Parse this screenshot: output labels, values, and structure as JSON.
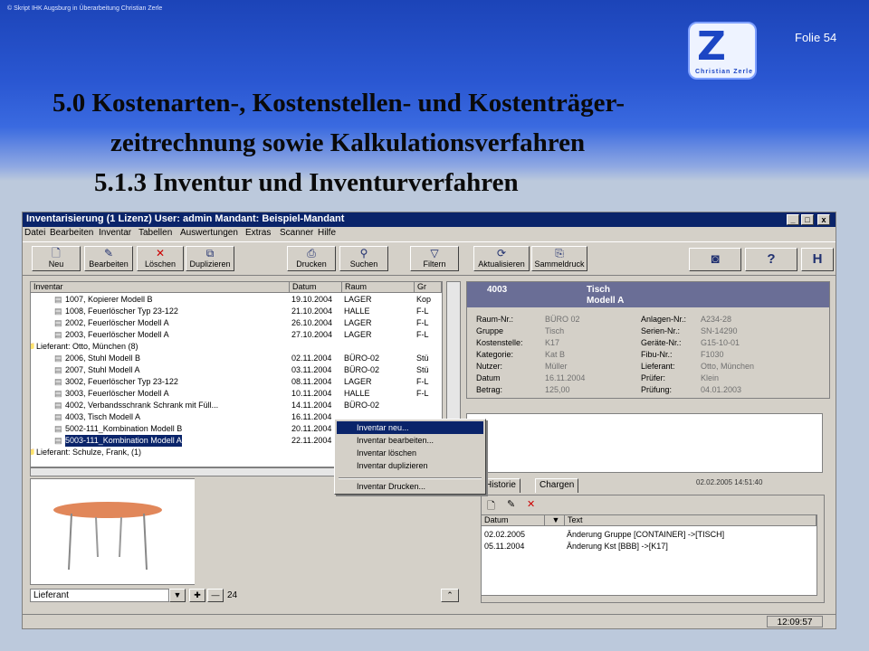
{
  "slide": {
    "copyright": "© Skript IHK Augsburg in Überarbeitung Christian Zerle",
    "folie": "Folie 54",
    "logo_text": "Christian Zerle",
    "title_line1": "5.0   Kostenarten-, Kostenstellen- und Kostenträger-",
    "title_line2": "zeitrechnung sowie Kalkulationsverfahren",
    "subtitle": "5.1.3  Inventur und Inventurverfahren"
  },
  "app": {
    "window_title": "Inventarisierung (1 Lizenz)  User: admin  Mandant: Beispiel-Mandant",
    "window_buttons": [
      "_",
      "□",
      "x"
    ],
    "menu": [
      "Datei",
      "Bearbeiten",
      "Inventar",
      "Tabellen",
      "Auswertungen",
      "Extras",
      "Scanner",
      "Hilfe"
    ],
    "toolbar": [
      {
        "label": "Neu",
        "icon": "new-doc-icon"
      },
      {
        "label": "Bearbeiten",
        "icon": "edit-icon"
      },
      {
        "label": "Löschen",
        "icon": "delete-icon"
      },
      {
        "label": "Duplizieren",
        "icon": "duplicate-icon"
      },
      {
        "label": "Drucken",
        "icon": "print-icon"
      },
      {
        "label": "Suchen",
        "icon": "binoculars-icon"
      },
      {
        "label": "Filtern",
        "icon": "filter-icon"
      },
      {
        "label": "Aktualisieren",
        "icon": "refresh-icon"
      },
      {
        "label": "Sammeldruck",
        "icon": "batch-print-icon"
      }
    ],
    "tree_columns": [
      "Inventar",
      "Datum",
      "Raum",
      "Gr"
    ],
    "tree_rows": [
      {
        "name": "1007, Kopierer Modell B",
        "date": "19.10.2004",
        "room": "LAGER",
        "gr": "Kop",
        "group": false
      },
      {
        "name": "1008, Feuerlöscher Typ 23-122",
        "date": "21.10.2004",
        "room": "HALLE",
        "gr": "F-L",
        "group": false
      },
      {
        "name": "2002, Feuerlöscher Modell A",
        "date": "26.10.2004",
        "room": "LAGER",
        "gr": "F-L",
        "group": false
      },
      {
        "name": "2003, Feuerlöscher Modell A",
        "date": "27.10.2004",
        "room": "LAGER",
        "gr": "F-L",
        "group": false
      },
      {
        "name": "Lieferant: Otto, München (8)",
        "date": "",
        "room": "",
        "gr": "",
        "group": true
      },
      {
        "name": "2006, Stuhl Modell B",
        "date": "02.11.2004",
        "room": "BÜRO-02",
        "gr": "Stü",
        "group": false
      },
      {
        "name": "2007, Stuhl Modell A",
        "date": "03.11.2004",
        "room": "BÜRO-02",
        "gr": "Stü",
        "group": false
      },
      {
        "name": "3002, Feuerlöscher Typ 23-122",
        "date": "08.11.2004",
        "room": "LAGER",
        "gr": "F-L",
        "group": false
      },
      {
        "name": "3003, Feuerlöscher Modell A",
        "date": "10.11.2004",
        "room": "HALLE",
        "gr": "F-L",
        "group": false
      },
      {
        "name": "4002, Verbandsschrank Schrank mit Füll...",
        "date": "14.11.2004",
        "room": "BÜRO-02",
        "gr": "",
        "group": false
      },
      {
        "name": "4003, Tisch Modell A",
        "date": "16.11.2004",
        "room": "",
        "gr": "",
        "group": false
      },
      {
        "name": "5002-111_Kombination Modell B",
        "date": "20.11.2004",
        "room": "",
        "gr": "",
        "group": false
      },
      {
        "name": "5003-111_Kombination Modell A",
        "date": "22.11.2004",
        "room": "",
        "gr": "",
        "group": false,
        "selected": true
      },
      {
        "name": "Lieferant: Schulze, Frank, (1)",
        "date": "",
        "room": "",
        "gr": "",
        "group": true
      }
    ],
    "filter_value": "Lieferant",
    "filter_count": "24",
    "detail": {
      "id": "4003",
      "name1": "Tisch",
      "name2": "Modell A",
      "left_fields": [
        {
          "label": "Raum-Nr.:",
          "value": "BÜRO 02"
        },
        {
          "label": "Gruppe",
          "value": "Tisch"
        },
        {
          "label": "Kostenstelle:",
          "value": "K17"
        },
        {
          "label": "Kategorie:",
          "value": "Kat B"
        },
        {
          "label": "Nutzer:",
          "value": "Müller"
        },
        {
          "label": "Datum",
          "value": "16.11.2004"
        },
        {
          "label": "Betrag:",
          "value": "125,00"
        }
      ],
      "right_fields": [
        {
          "label": "Anlagen-Nr.:",
          "value": "A234-28"
        },
        {
          "label": "Serien-Nr.:",
          "value": "SN-14290"
        },
        {
          "label": "Geräte-Nr.:",
          "value": "G15-10-01"
        },
        {
          "label": "Fibu-Nr.:",
          "value": "F1030"
        },
        {
          "label": "Lieferant:",
          "value": "Otto, München"
        },
        {
          "label": "Prüfer:",
          "value": "Klein"
        },
        {
          "label": "Prüfung:",
          "value": "04.01.2003"
        }
      ],
      "memo_timestamp": "02.02.2005 14:51:40"
    },
    "tabs": [
      "Historie",
      "Chargen"
    ],
    "history_columns": [
      "Datum",
      "Text"
    ],
    "history_rows": [
      {
        "date": "02.02.2005",
        "text": "Änderung Gruppe [CONTAINER] ->[TISCH]"
      },
      {
        "date": "05.11.2004",
        "text": "Änderung Kst [BBB] ->[K17]"
      }
    ],
    "context_menu": [
      "Inventar neu...",
      "Inventar bearbeiten...",
      "Inventar löschen",
      "Inventar duplizieren",
      "Inventar Drucken..."
    ],
    "status_time": "12:09:57"
  }
}
